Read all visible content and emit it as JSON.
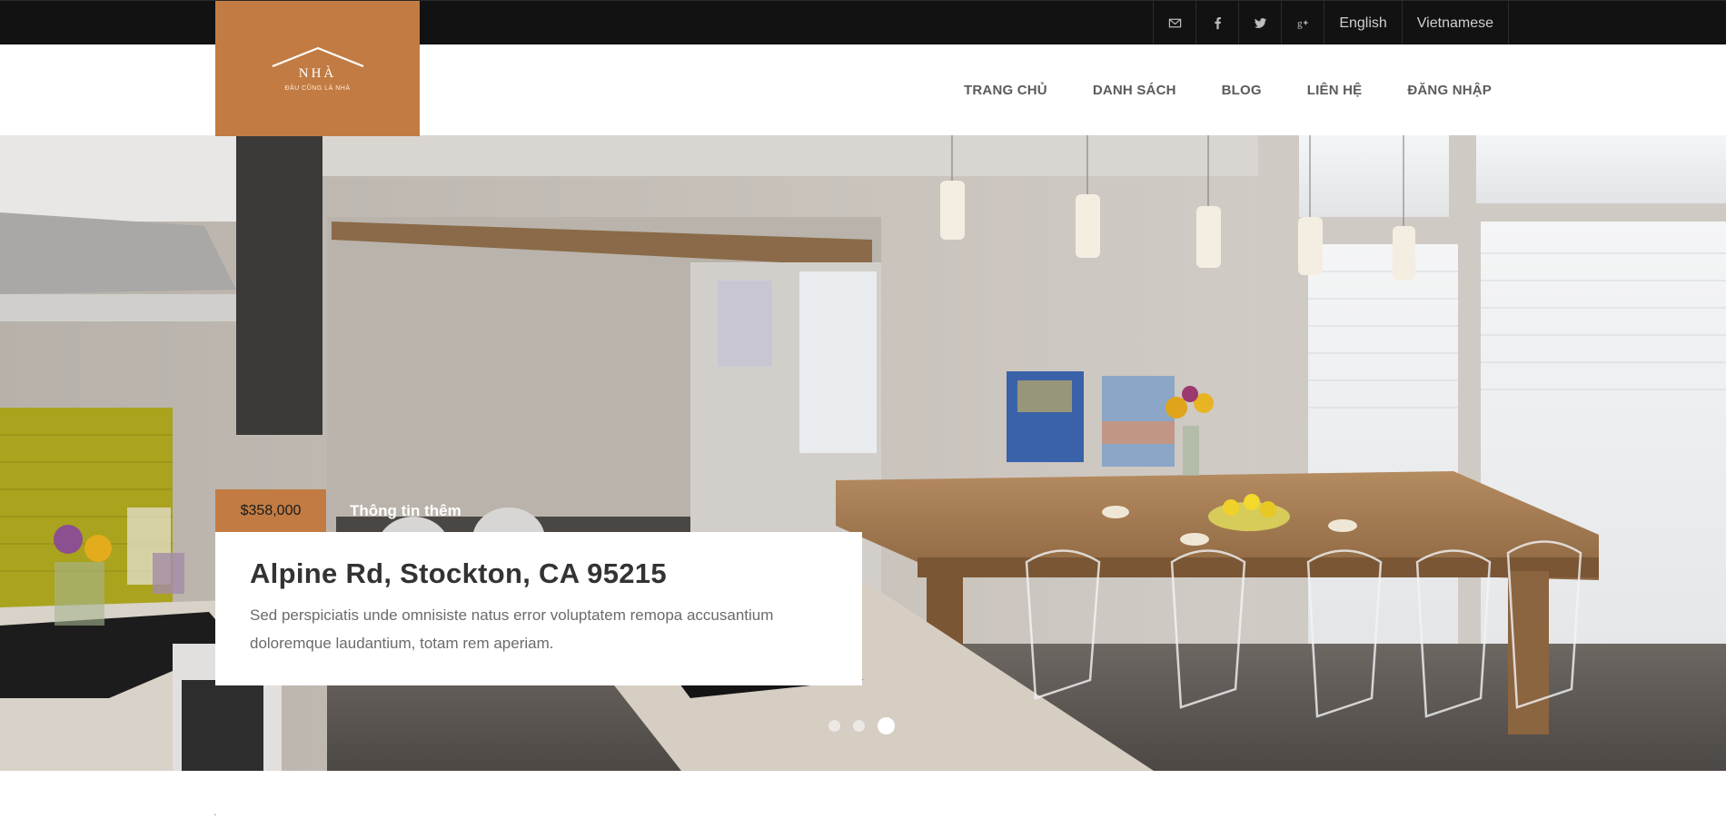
{
  "topbar": {
    "icons": [
      "envelope-icon",
      "facebook-icon",
      "twitter-icon",
      "google-plus-icon"
    ],
    "languages": [
      "English",
      "Vietnamese"
    ]
  },
  "logo": {
    "title": "NHÀ",
    "tagline": "ĐÂU CŨNG LÀ NHÀ",
    "color": "#c27c43"
  },
  "nav": {
    "items": [
      "TRANG CHỦ",
      "DANH SÁCH",
      "BLOG",
      "LIÊN HỆ",
      "ĐĂNG NHẬP"
    ]
  },
  "slider": {
    "price": "$358,000",
    "more_label": "Thông tin thêm",
    "title": "Alpine Rd, Stockton, CA 95215",
    "description": "Sed perspiciatis unde omnisiste natus error voluptatem remopa accusantium doloremque laudantium, totam rem aperiam.",
    "slide_count": 3,
    "active_slide": 3
  },
  "colors": {
    "accent": "#c27c43",
    "topbar_bg": "#121212"
  }
}
